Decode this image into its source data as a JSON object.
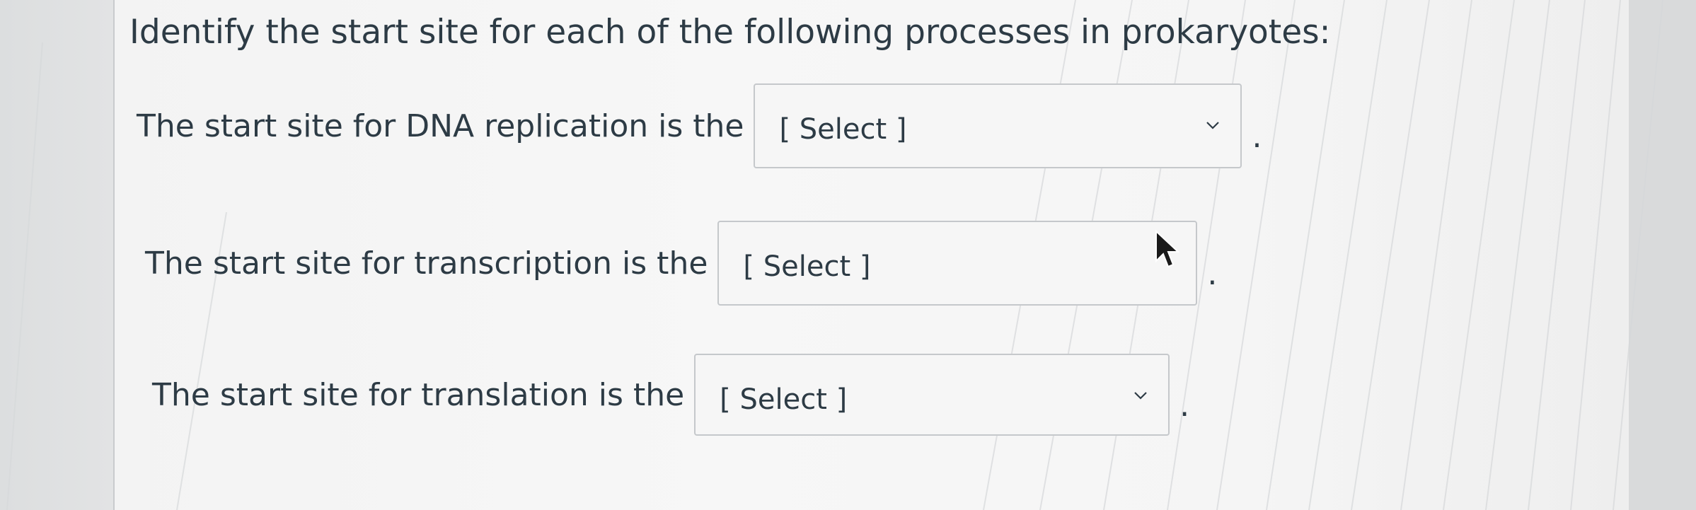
{
  "question": {
    "prompt": "Identify the start site for each of the following processes in prokaryotes:"
  },
  "rows": [
    {
      "label": "The start site for DNA replication is the",
      "select_value": "[ Select ]",
      "period": "."
    },
    {
      "label": "The start site for transcription is the",
      "select_value": "[ Select ]",
      "period": "."
    },
    {
      "label": "The start site for translation is the",
      "select_value": "[ Select ]",
      "period": "."
    }
  ],
  "icons": {
    "dropdown": "chevron-down-icon",
    "pointer": "mouse-pointer-icon"
  }
}
